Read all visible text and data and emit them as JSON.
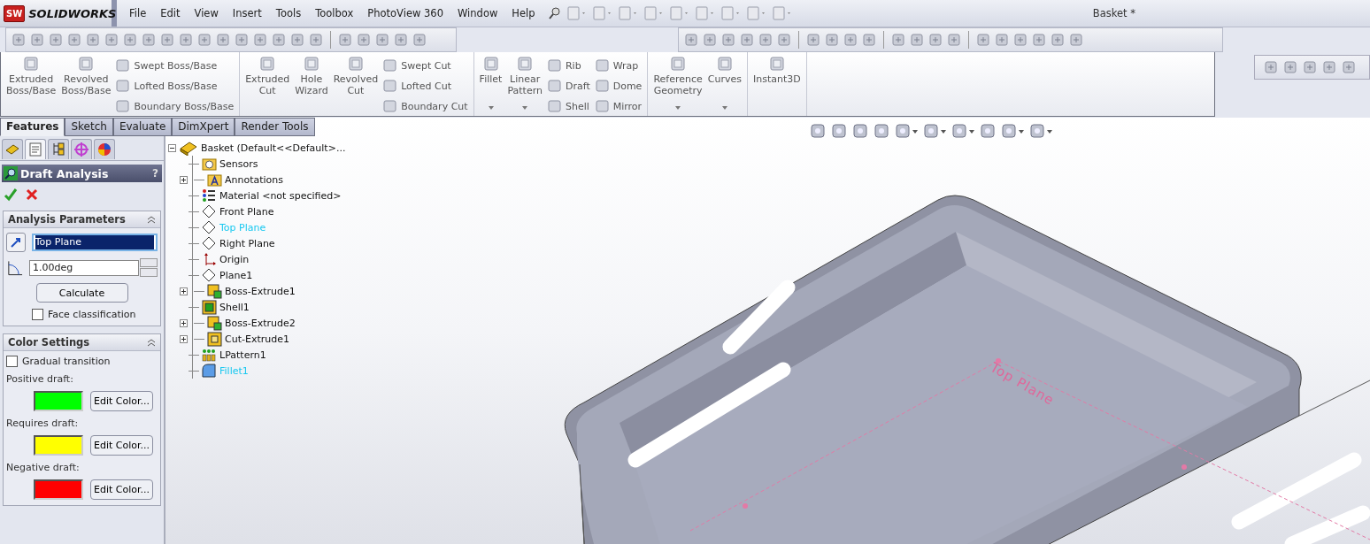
{
  "app": {
    "badge": "SW",
    "logo": "SOLIDWORKS",
    "title": "Basket *"
  },
  "menu": [
    "File",
    "Edit",
    "View",
    "Insert",
    "Tools",
    "Toolbox",
    "PhotoView 360",
    "Window",
    "Help"
  ],
  "ribbon": [
    [
      {
        "kind": "large",
        "label": "Extruded Boss/Base",
        "dropdown": false
      },
      {
        "kind": "large",
        "label": "Revolved Boss/Base",
        "dropdown": false
      },
      {
        "kind": "stack",
        "items": [
          "Swept Boss/Base",
          "Lofted Boss/Base",
          "Boundary Boss/Base"
        ]
      }
    ],
    [
      {
        "kind": "large",
        "label": "Extruded Cut",
        "dropdown": false
      },
      {
        "kind": "large",
        "label": "Hole Wizard",
        "dropdown": false
      },
      {
        "kind": "large",
        "label": "Revolved Cut",
        "dropdown": false
      },
      {
        "kind": "stack",
        "items": [
          "Swept Cut",
          "Lofted Cut",
          "Boundary Cut"
        ]
      }
    ],
    [
      {
        "kind": "large",
        "label": "Fillet",
        "dropdown": true
      },
      {
        "kind": "large",
        "label": "Linear Pattern",
        "dropdown": true
      },
      {
        "kind": "stack",
        "items": [
          "Rib",
          "Draft",
          "Shell"
        ]
      },
      {
        "kind": "stack",
        "items": [
          "Wrap",
          "Dome",
          "Mirror"
        ]
      }
    ],
    [
      {
        "kind": "large",
        "label": "Reference Geometry",
        "dropdown": true
      },
      {
        "kind": "large",
        "label": "Curves",
        "dropdown": true
      }
    ],
    [
      {
        "kind": "large",
        "label": "Instant3D",
        "dropdown": false
      }
    ]
  ],
  "tabs": [
    {
      "label": "Features",
      "selected": true
    },
    {
      "label": "Sketch",
      "selected": false
    },
    {
      "label": "Evaluate",
      "selected": false
    },
    {
      "label": "DimXpert",
      "selected": false
    },
    {
      "label": "Render Tools",
      "selected": false
    }
  ],
  "panel_tabs": [
    {
      "kind": "tree",
      "selected": false
    },
    {
      "kind": "property",
      "selected": true
    },
    {
      "kind": "config",
      "selected": false
    },
    {
      "kind": "target",
      "selected": false
    },
    {
      "kind": "display",
      "selected": false
    }
  ],
  "property_manager": {
    "title": "Draft Analysis",
    "help": "?",
    "analysis": {
      "title": "Analysis Parameters",
      "direction": {
        "value": "Top Plane",
        "selected": true
      },
      "angle": "1.00deg",
      "calculate": "Calculate",
      "face_classification": {
        "label": "Face classification",
        "checked": false
      }
    },
    "colors": {
      "title": "Color Settings",
      "gradual": {
        "label": "Gradual transition",
        "checked": false
      },
      "rows": [
        {
          "label": "Positive draft:",
          "color": "#00ff00",
          "button": "Edit Color..."
        },
        {
          "label": "Requires draft:",
          "color": "#ffff00",
          "button": "Edit Color..."
        },
        {
          "label": "Negative draft:",
          "color": "#ff0000",
          "button": "Edit Color..."
        }
      ]
    }
  },
  "tree": {
    "label": "Basket  (Default<<Default>...",
    "expanded": true,
    "children": [
      {
        "label": "Sensors",
        "kind": "sensors",
        "expandable": false,
        "highlighted": false
      },
      {
        "label": "Annotations",
        "kind": "annotations",
        "expandable": true,
        "highlighted": false
      },
      {
        "label": "Material <not specified>",
        "kind": "material",
        "expandable": false,
        "highlighted": false
      },
      {
        "label": "Front Plane",
        "kind": "plane",
        "expandable": false,
        "highlighted": false
      },
      {
        "label": "Top Plane",
        "kind": "plane",
        "expandable": false,
        "highlighted": true
      },
      {
        "label": "Right Plane",
        "kind": "plane",
        "expandable": false,
        "highlighted": false
      },
      {
        "label": "Origin",
        "kind": "origin",
        "expandable": false,
        "highlighted": false
      },
      {
        "label": "Plane1",
        "kind": "plane",
        "expandable": false,
        "highlighted": false
      },
      {
        "label": "Boss-Extrude1",
        "kind": "extrude",
        "expandable": true,
        "highlighted": false
      },
      {
        "label": "Shell1",
        "kind": "shell",
        "expandable": false,
        "highlighted": false
      },
      {
        "label": "Boss-Extrude2",
        "kind": "extrude",
        "expandable": true,
        "highlighted": false
      },
      {
        "label": "Cut-Extrude1",
        "kind": "cut",
        "expandable": true,
        "highlighted": false
      },
      {
        "label": "LPattern1",
        "kind": "pattern",
        "expandable": false,
        "highlighted": false
      },
      {
        "label": "Fillet1",
        "kind": "fillet",
        "expandable": false,
        "highlighted": true
      }
    ]
  },
  "viewport": {
    "plane_label": "Top Plane"
  }
}
